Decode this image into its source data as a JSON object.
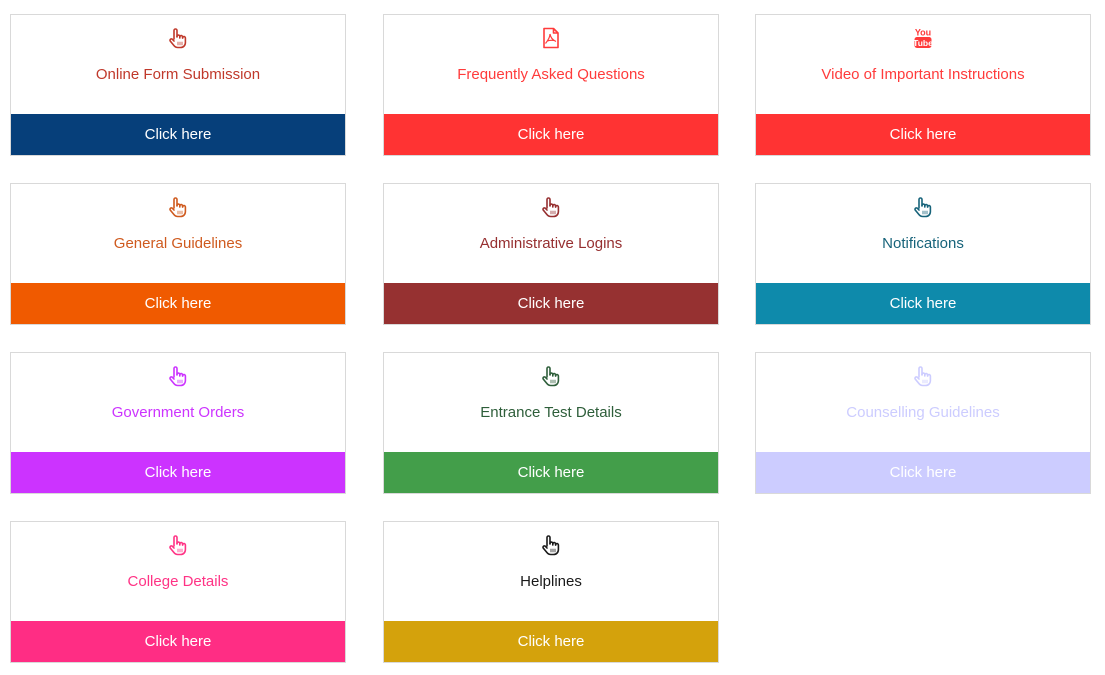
{
  "cards": [
    {
      "title": "Online Form Submission",
      "icon": "hand-pointer-icon",
      "button": "Click here",
      "text_color": "#c0392b",
      "bar_color": "#063f7a"
    },
    {
      "title": "Frequently Asked Questions",
      "icon": "pdf-file-icon",
      "button": "Click here",
      "text_color": "#ff3b3b",
      "bar_color": "#ff3333"
    },
    {
      "title": "Video of Important Instructions",
      "icon": "youtube-icon",
      "button": "Click here",
      "text_color": "#ff3b3b",
      "bar_color": "#ff3333"
    },
    {
      "title": "General Guidelines",
      "icon": "hand-pointer-icon",
      "button": "Click here",
      "text_color": "#cf5a1e",
      "bar_color": "#f05a00"
    },
    {
      "title": "Administrative Logins",
      "icon": "hand-pointer-icon",
      "button": "Click here",
      "text_color": "#962f30",
      "bar_color": "#963131"
    },
    {
      "title": "Notifications",
      "icon": "hand-pointer-icon",
      "button": "Click here",
      "text_color": "#17637a",
      "bar_color": "#0e8aab"
    },
    {
      "title": "Government Orders",
      "icon": "hand-pointer-icon",
      "button": "Click here",
      "text_color": "#cc33ff",
      "bar_color": "#cc33ff"
    },
    {
      "title": "Entrance Test Details",
      "icon": "hand-pointer-icon",
      "button": "Click here",
      "text_color": "#2e5e3a",
      "bar_color": "#439e4a"
    },
    {
      "title": "Counselling Guidelines",
      "icon": "hand-pointer-icon",
      "button": "Click here",
      "text_color": "#ccccff",
      "bar_color": "#ccccff"
    },
    {
      "title": "College Details",
      "icon": "hand-pointer-icon",
      "button": "Click here",
      "text_color": "#ff3385",
      "bar_color": "#ff2d84"
    },
    {
      "title": "Helplines",
      "icon": "hand-pointer-icon",
      "button": "Click here",
      "text_color": "#1a1a1a",
      "bar_color": "#d4a20c"
    }
  ]
}
